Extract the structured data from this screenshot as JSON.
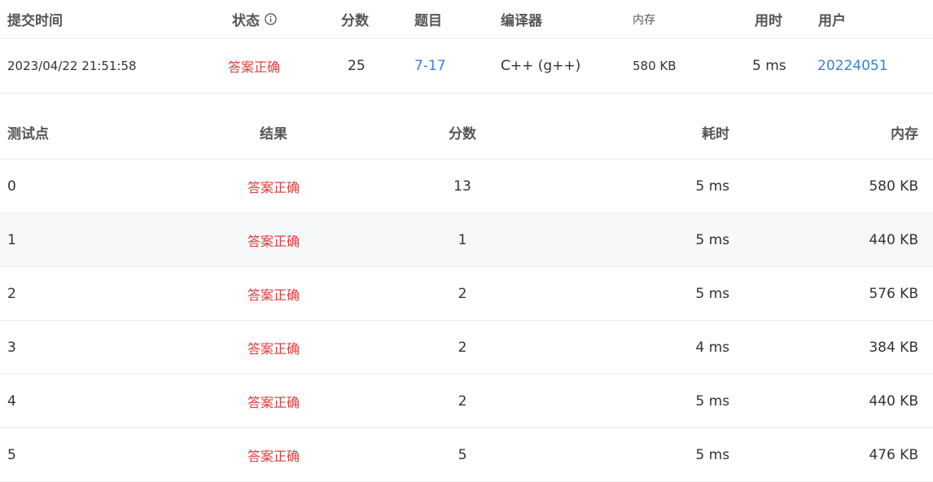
{
  "submission": {
    "headers": {
      "time": "提交时间",
      "status": "状态",
      "score": "分数",
      "problem": "题目",
      "compiler": "编译器",
      "memory": "内存",
      "duration": "用时",
      "user": "用户"
    },
    "row": {
      "time": "2023/04/22 21:51:58",
      "status": "答案正确",
      "score": "25",
      "problem": "7-17",
      "compiler": "C++ (g++)",
      "memory": "580 KB",
      "duration": "5 ms",
      "user": "20224051"
    }
  },
  "cases": {
    "headers": {
      "case": "测试点",
      "result": "结果",
      "score": "分数",
      "time": "耗时",
      "memory": "内存"
    },
    "rows": [
      {
        "case": "0",
        "result": "答案正确",
        "score": "13",
        "time": "5 ms",
        "memory": "580 KB"
      },
      {
        "case": "1",
        "result": "答案正确",
        "score": "1",
        "time": "5 ms",
        "memory": "440 KB"
      },
      {
        "case": "2",
        "result": "答案正确",
        "score": "2",
        "time": "5 ms",
        "memory": "576 KB"
      },
      {
        "case": "3",
        "result": "答案正确",
        "score": "2",
        "time": "4 ms",
        "memory": "384 KB"
      },
      {
        "case": "4",
        "result": "答案正确",
        "score": "2",
        "time": "5 ms",
        "memory": "440 KB"
      },
      {
        "case": "5",
        "result": "答案正确",
        "score": "5",
        "time": "5 ms",
        "memory": "476 KB"
      }
    ]
  },
  "colors": {
    "accepted": "#e03c3c",
    "link": "#3a7fd5",
    "stripe": "#f7f8fa"
  }
}
